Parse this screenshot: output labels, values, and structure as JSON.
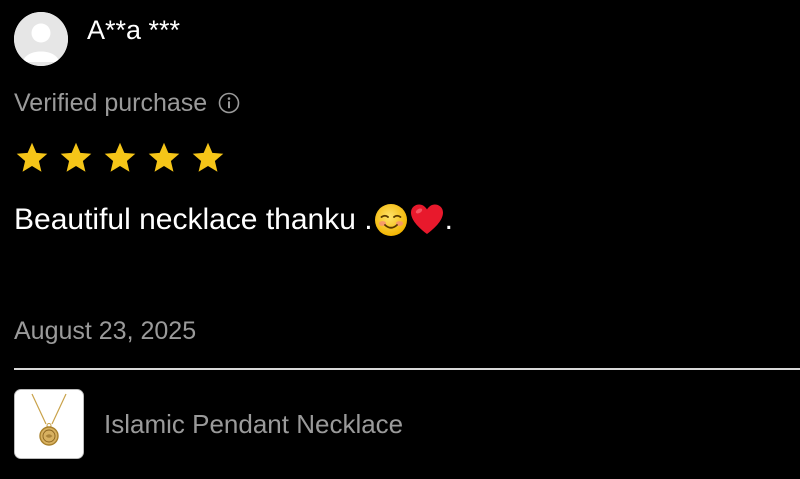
{
  "reviewer": {
    "avatar_icon": "default-user-avatar",
    "name": "A**a ***"
  },
  "verification": {
    "label": "Verified purchase",
    "info_icon": "info-circle-icon"
  },
  "rating": {
    "value": 5,
    "max": 5,
    "star_color": "#F5C518"
  },
  "review": {
    "text_before": "Beautiful necklace thanku .",
    "emojis": [
      "smiling-face-emoji",
      "red-heart-emoji"
    ],
    "text_after": "."
  },
  "date": "August 23, 2025",
  "product": {
    "thumbnail_icon": "pendant-necklace-thumbnail",
    "name": "Islamic Pendant Necklace"
  }
}
